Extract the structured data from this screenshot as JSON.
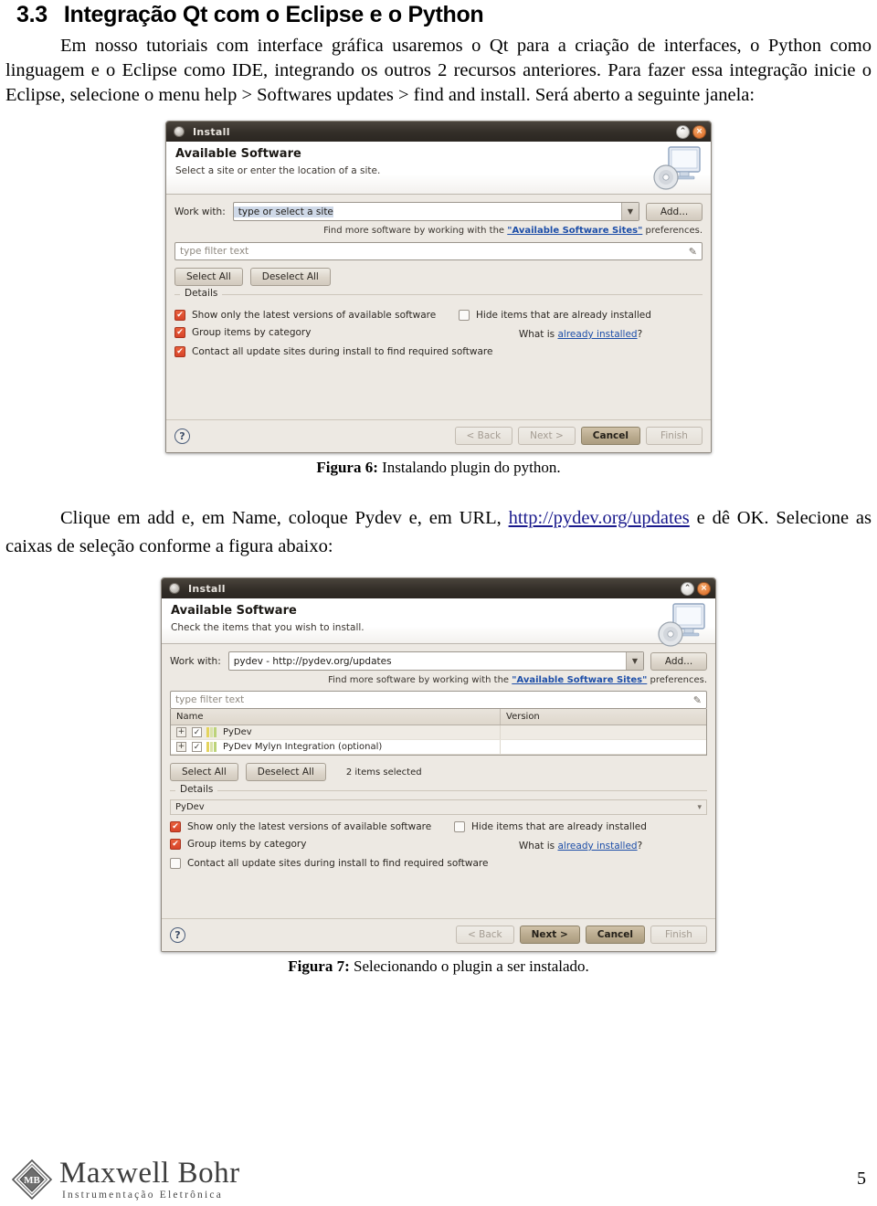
{
  "document": {
    "heading": {
      "number": "3.3",
      "text": "Integração Qt com o  Eclipse e o Python"
    },
    "paragraph1": "Em nosso tutoriais com interface gráfica usaremos o Qt para a criação de interfaces, o Python como linguagem e o Eclipse como IDE, integrando os outros 2 recursos anteriores. Para fazer essa integração inicie o Eclipse, selecione o menu help > Softwares updates > find and install. Será aberto a seguinte janela:",
    "figure6_caption_label": "Figura 6:",
    "figure6_caption_text": "Instalando plugin do python.",
    "paragraph2_part1": "Clique em add e, em Name, coloque Pydev e, em URL, ",
    "paragraph2_link": "http://pydev.org/updates",
    "paragraph2_part2": " e dê OK. Selecione as caixas de seleção conforme a figura abaixo:",
    "figure7_caption_label": "Figura 7:",
    "figure7_caption_text": "Selecionando o plugin a ser instalado.",
    "footer": {
      "logo_name": "Maxwell Bohr",
      "logo_tagline": "Instrumentação Eletrônica",
      "logo_monogram": "MB",
      "page_number": "5"
    }
  },
  "dialog1": {
    "titlebar": {
      "title": "Install",
      "restore_glyph": "⌃",
      "close_glyph": "×"
    },
    "banner": {
      "title": "Available Software",
      "subtitle": "Select a site or enter the location of a site."
    },
    "work_with": {
      "label": "Work with:",
      "value": "type or select a site",
      "dropdown_glyph": "▼",
      "add_button": "Add..."
    },
    "hint": {
      "prefix": "Find more software by working with the ",
      "link": "\"Available Software Sites\"",
      "suffix": " preferences."
    },
    "filter": {
      "placeholder": "type filter text"
    },
    "buttons": {
      "select_all": "Select All",
      "deselect_all": "Deselect All"
    },
    "details_group_label": "Details",
    "checkboxes": [
      {
        "label": "Show only the latest versions of available software",
        "checked": true
      },
      {
        "label": "Group items by category",
        "checked": true
      },
      {
        "label": "Contact all update sites during install to find required software",
        "checked": true
      },
      {
        "label": "Hide items that are already installed",
        "checked": false
      }
    ],
    "what_is": {
      "prefix": "What is ",
      "link": "already installed",
      "suffix": "?"
    },
    "footer": {
      "help_glyph": "?",
      "back": "< Back",
      "next": "Next >",
      "cancel": "Cancel",
      "finish": "Finish",
      "default_button": "Cancel"
    }
  },
  "dialog2": {
    "titlebar": {
      "title": "Install",
      "restore_glyph": "⌃",
      "close_glyph": "×"
    },
    "banner": {
      "title": "Available Software",
      "subtitle": "Check the items that you wish to install."
    },
    "work_with": {
      "label": "Work with:",
      "value": "pydev - http://pydev.org/updates",
      "dropdown_glyph": "▼",
      "add_button": "Add..."
    },
    "hint": {
      "prefix": "Find more software by working with the ",
      "link": "\"Available Software Sites\"",
      "suffix": " preferences."
    },
    "filter": {
      "placeholder": "type filter text"
    },
    "table": {
      "columns": [
        "Name",
        "Version"
      ],
      "rows": [
        {
          "expander": "+",
          "checked": true,
          "name": "PyDev",
          "version": ""
        },
        {
          "expander": "+",
          "checked": true,
          "name": "PyDev Mylyn Integration (optional)",
          "version": ""
        }
      ]
    },
    "buttons": {
      "select_all": "Select All",
      "deselect_all": "Deselect All"
    },
    "selection_status": "2 items selected",
    "details_group_label": "Details",
    "details_value": "PyDev",
    "checkboxes": [
      {
        "label": "Show only the latest versions of available software",
        "checked": true
      },
      {
        "label": "Group items by category",
        "checked": true
      },
      {
        "label": "Contact all update sites during install to find required software",
        "checked": false
      },
      {
        "label": "Hide items that are already installed",
        "checked": false
      }
    ],
    "what_is": {
      "prefix": "What is ",
      "link": "already installed",
      "suffix": "?"
    },
    "footer": {
      "help_glyph": "?",
      "back": "< Back",
      "next": "Next >",
      "cancel": "Cancel",
      "finish": "Finish",
      "default_button": "Next >"
    }
  },
  "colors": {
    "dialog_bg": "#EDE9E3",
    "titlebar": "#332E28",
    "checkbox_checked": "#DE4B2C",
    "link": "#1D4EA8",
    "close_button": "#D9651F"
  }
}
